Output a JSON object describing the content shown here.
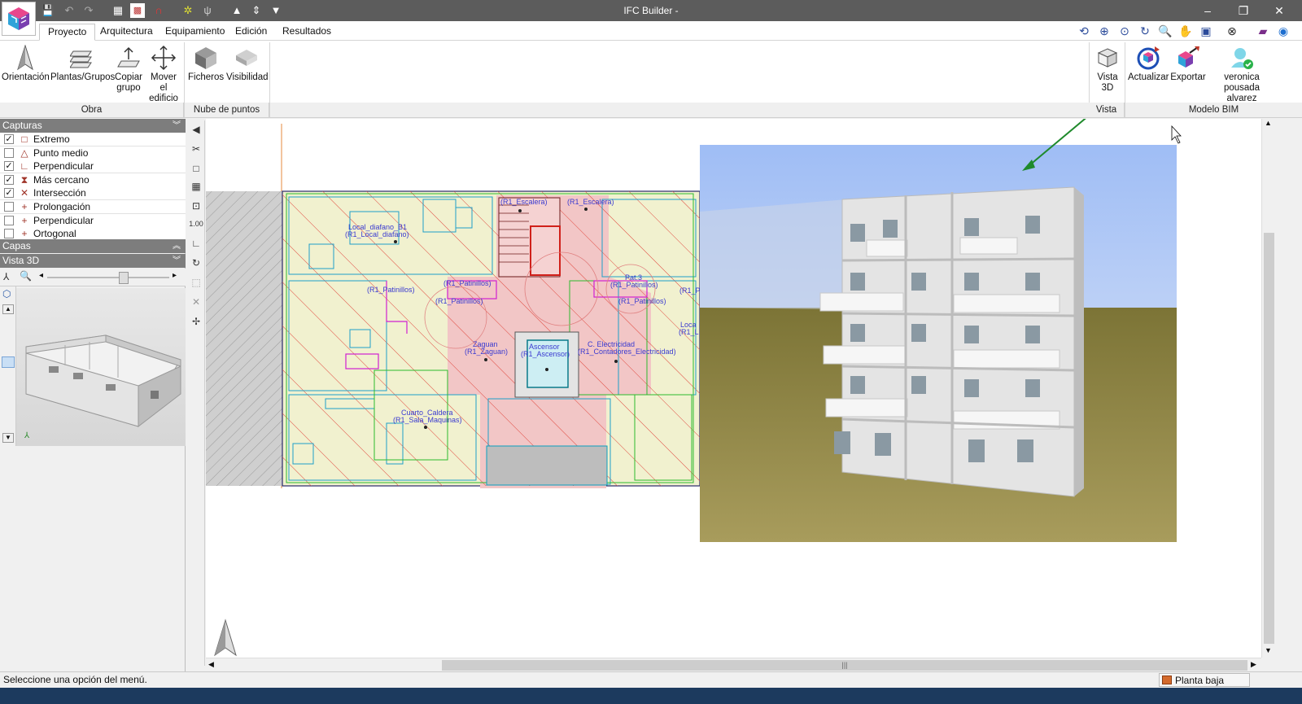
{
  "window": {
    "title": "IFC Builder -"
  },
  "tabs": [
    "Proyecto",
    "Arquitectura",
    "Equipamiento",
    "Edición",
    "Resultados"
  ],
  "ribbon": {
    "obra": {
      "label": "Obra",
      "buttons": [
        "Orientación",
        "Plantas/Grupos",
        "Copiar grupo",
        "Mover el edificio"
      ]
    },
    "nube": {
      "label": "Nube de puntos",
      "buttons": [
        "Ficheros",
        "Visibilidad"
      ]
    },
    "vista3d": {
      "label": "Vista 3D",
      "button": "Vista 3D"
    },
    "bim": {
      "label": "Modelo BIM",
      "buttons": [
        "Actualizar",
        "Exportar",
        "veronica pousada alvarez"
      ]
    }
  },
  "left_panel": {
    "capturas": {
      "title": "Capturas",
      "items": [
        {
          "label": "Extremo",
          "checked": true,
          "icon": "square-snap-icon"
        },
        {
          "label": "Punto medio",
          "checked": false,
          "icon": "triangle-snap-icon"
        },
        {
          "label": "Perpendicular",
          "checked": true,
          "icon": "perpendicular-snap-icon"
        },
        {
          "label": "Más cercano",
          "checked": true,
          "icon": "hourglass-snap-icon"
        },
        {
          "label": "Intersección",
          "checked": true,
          "icon": "cross-snap-icon"
        },
        {
          "label": "Prolongación",
          "checked": false,
          "icon": "plus-snap-icon"
        },
        {
          "label": "Perpendicular",
          "checked": false,
          "icon": "plus-snap-icon"
        },
        {
          "label": "Ortogonal",
          "checked": false,
          "icon": "plus-snap-icon"
        }
      ]
    },
    "capas": {
      "title": "Capas"
    },
    "vista3d": {
      "title": "Vista 3D"
    }
  },
  "plan_labels": [
    "Local_diafano_B1",
    "(R1_Local_diafano)",
    "(R1_Escalera)",
    "(R1_Patinillos)",
    "Zaguan",
    "(R1_Zaguan)",
    "Ascensor",
    "(R1_Ascensor)",
    "C. Electricidad",
    "(R1_Contadores_Electricidad)",
    "Cuarto_Caldera",
    "(R1_Sala_Maquinas)",
    "Pat.3",
    "(R1_Patinillos)",
    "Loca",
    "(R1_L"
  ],
  "status": {
    "message": "Seleccione una opción del menú.",
    "floor": "Planta baja"
  },
  "colors": {
    "titlebar": "#5c5c5c",
    "panel_header": "#7d7d7d",
    "plan_fill": "#f1f1cf",
    "core_fill": "#f2c6c6",
    "arrow": "#1f8a2c"
  }
}
